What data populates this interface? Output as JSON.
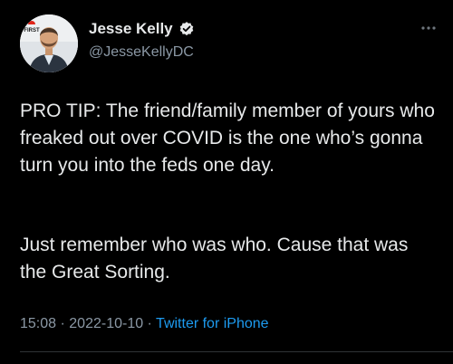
{
  "author": {
    "display_name": "Jesse Kelly",
    "handle": "@JesseKellyDC",
    "verified_icon": "verified-badge-icon",
    "avatar_logo_text": "FIRST"
  },
  "tweet": {
    "paragraphs": [
      "PRO TIP: The friend/family member of yours who freaked out over COVID is the one who’s gonna turn you into the feds one day.",
      "Just remember who was who. Cause that was the Great Sorting."
    ],
    "time": "15:08",
    "separator": " · ",
    "date": "2022-10-10",
    "source": "Twitter for iPhone"
  },
  "colors": {
    "background": "#000000",
    "text": "#e7e9ea",
    "secondary": "#8b98a5",
    "link": "#1d9bf0"
  },
  "icons": {
    "more": "more-options-icon"
  }
}
